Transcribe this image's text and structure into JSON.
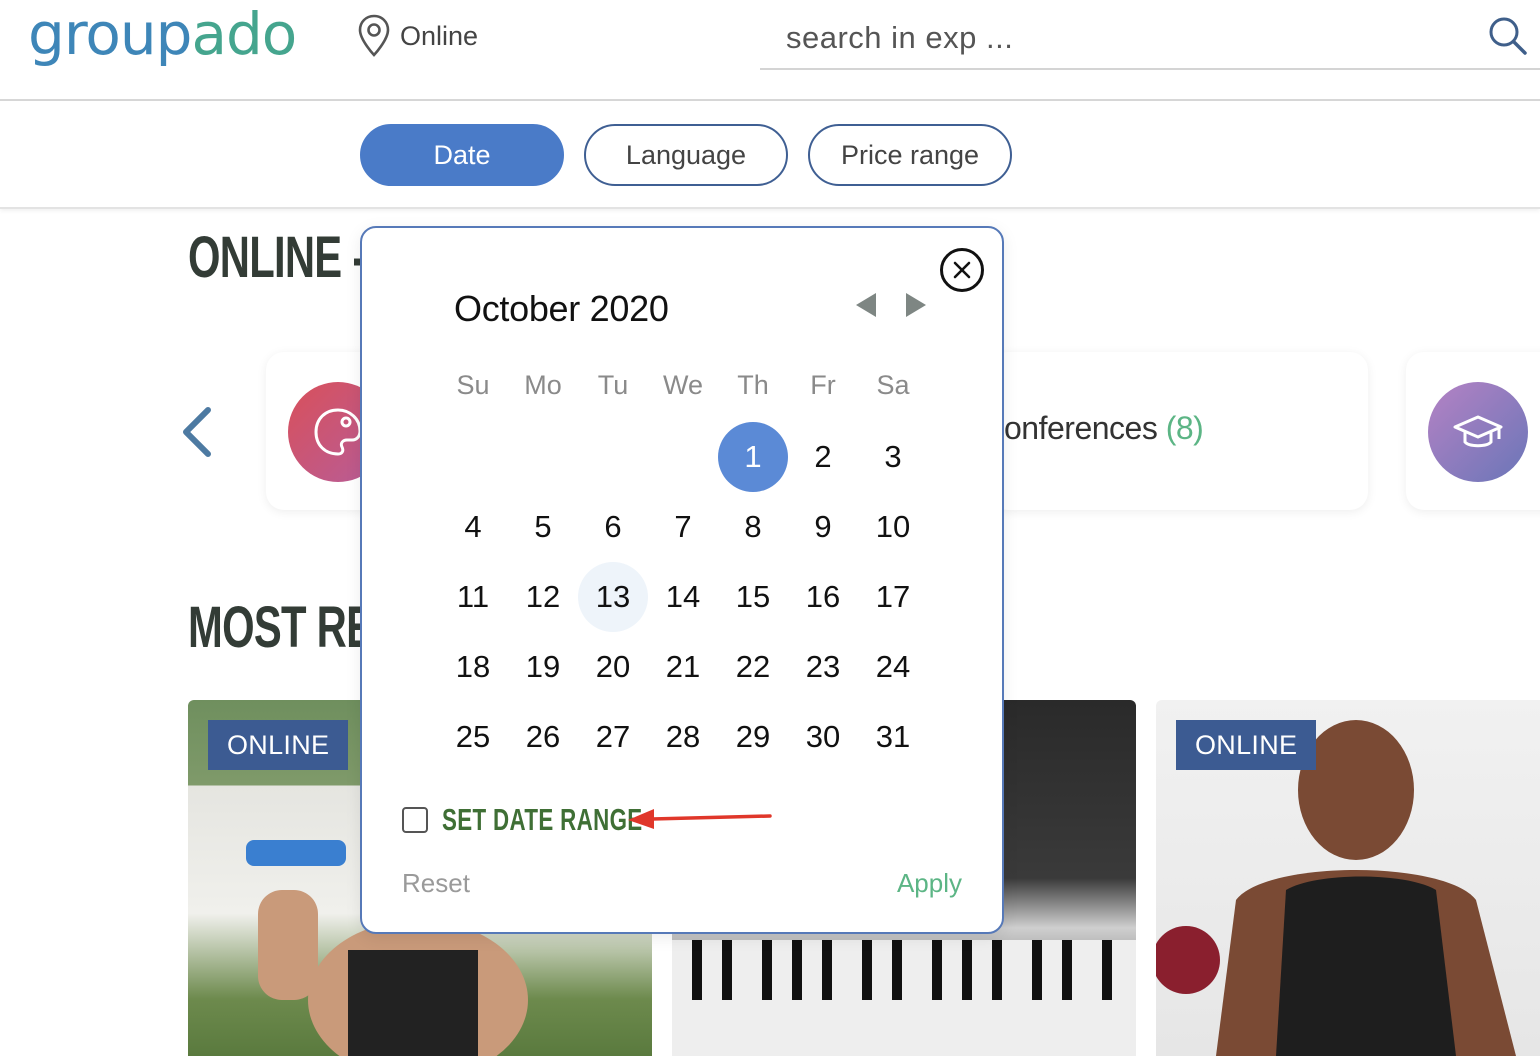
{
  "header": {
    "logo_part1": "group",
    "logo_part2": "ado",
    "location": "Online",
    "search_placeholder": "search in exp ..."
  },
  "filters": {
    "date": "Date",
    "language": "Language",
    "price_range": "Price range"
  },
  "sections": {
    "online_title": "ONLINE -",
    "most_title": "MOST RE"
  },
  "categories": {
    "visible_label": "onferences",
    "visible_count": "(8)"
  },
  "cards": {
    "badge1": "ONLINE",
    "badge2": "ONLINE"
  },
  "calendar": {
    "month_label": "October 2020",
    "weekdays": [
      "Su",
      "Mo",
      "Tu",
      "We",
      "Th",
      "Fr",
      "Sa"
    ],
    "leading_blanks": 4,
    "days_in_month": 31,
    "selected_day": 1,
    "today_day": 13,
    "set_range_label": "SET DATE RANGE",
    "reset_label": "Reset",
    "apply_label": "Apply"
  },
  "colors": {
    "primary": "#4a7bc8",
    "selected_day": "#5b8ad6",
    "apply_green": "#5cb585",
    "range_label_green": "#3f6f35",
    "badge": "#3c5b92",
    "annotation_arrow": "#e0372a"
  }
}
